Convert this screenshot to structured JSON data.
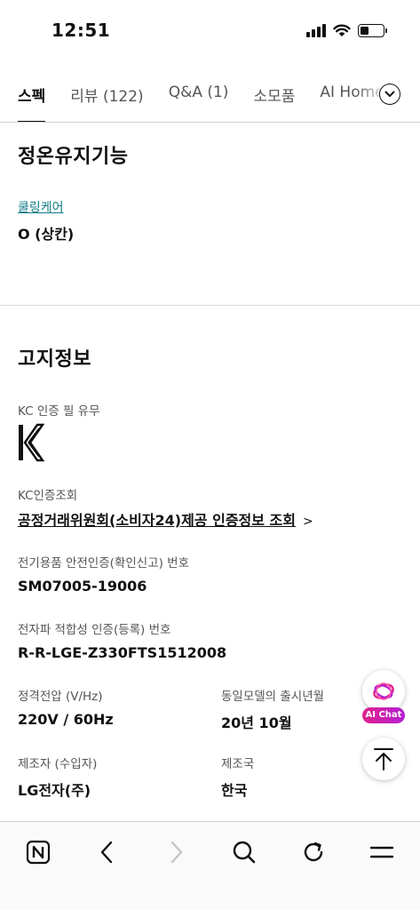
{
  "status_bar": {
    "time": "12:51"
  },
  "tabs": [
    {
      "label": "스펙",
      "active": true
    },
    {
      "label": "리뷰 (122)",
      "active": false
    },
    {
      "label": "Q&A (1)",
      "active": false
    },
    {
      "label": "소모품",
      "active": false
    },
    {
      "label": "AI Home",
      "active": false
    }
  ],
  "warm_section": {
    "title": "정온유지기능",
    "item_label": "쿨링케어",
    "item_value": "O (상칸)"
  },
  "notice_section": {
    "title": "고지정보",
    "kc_label": "KC 인증 필 유무",
    "kc_lookup_label": "KC인증조회",
    "kc_lookup_link": "공정거래위원회(소비자24)제공 인증정보 조회",
    "safety_label": "전기용품 안전인증(확인신고) 번호",
    "safety_value": "SM07005-19006",
    "emc_label": "전자파 적합성 인증(등록) 번호",
    "emc_value": "R-R-LGE-Z330FTS1512008",
    "voltage_label": "정격전압 (V/Hz)",
    "voltage_value": "220V / 60Hz",
    "release_label": "동일모델의 출시년월",
    "release_value": "20년 10월",
    "maker_label": "제조자 (수입자)",
    "maker_value": "LG전자(주)",
    "country_label": "제조국",
    "country_value": "한국"
  },
  "floating": {
    "ai_chat_label": "AI Chat"
  },
  "colors": {
    "link_teal": "#0f7b84",
    "ai_gradient_start": "#e0218a",
    "ai_gradient_end": "#b41fd6"
  },
  "icons": [
    "signal-icon",
    "wifi-icon",
    "battery-icon",
    "chevron-down-icon",
    "kc-mark-icon",
    "chevron-right-icon",
    "ai-chat-icon",
    "arrow-up-icon",
    "naver-n-icon",
    "back-icon",
    "forward-icon",
    "search-icon",
    "refresh-icon",
    "menu-icon"
  ]
}
